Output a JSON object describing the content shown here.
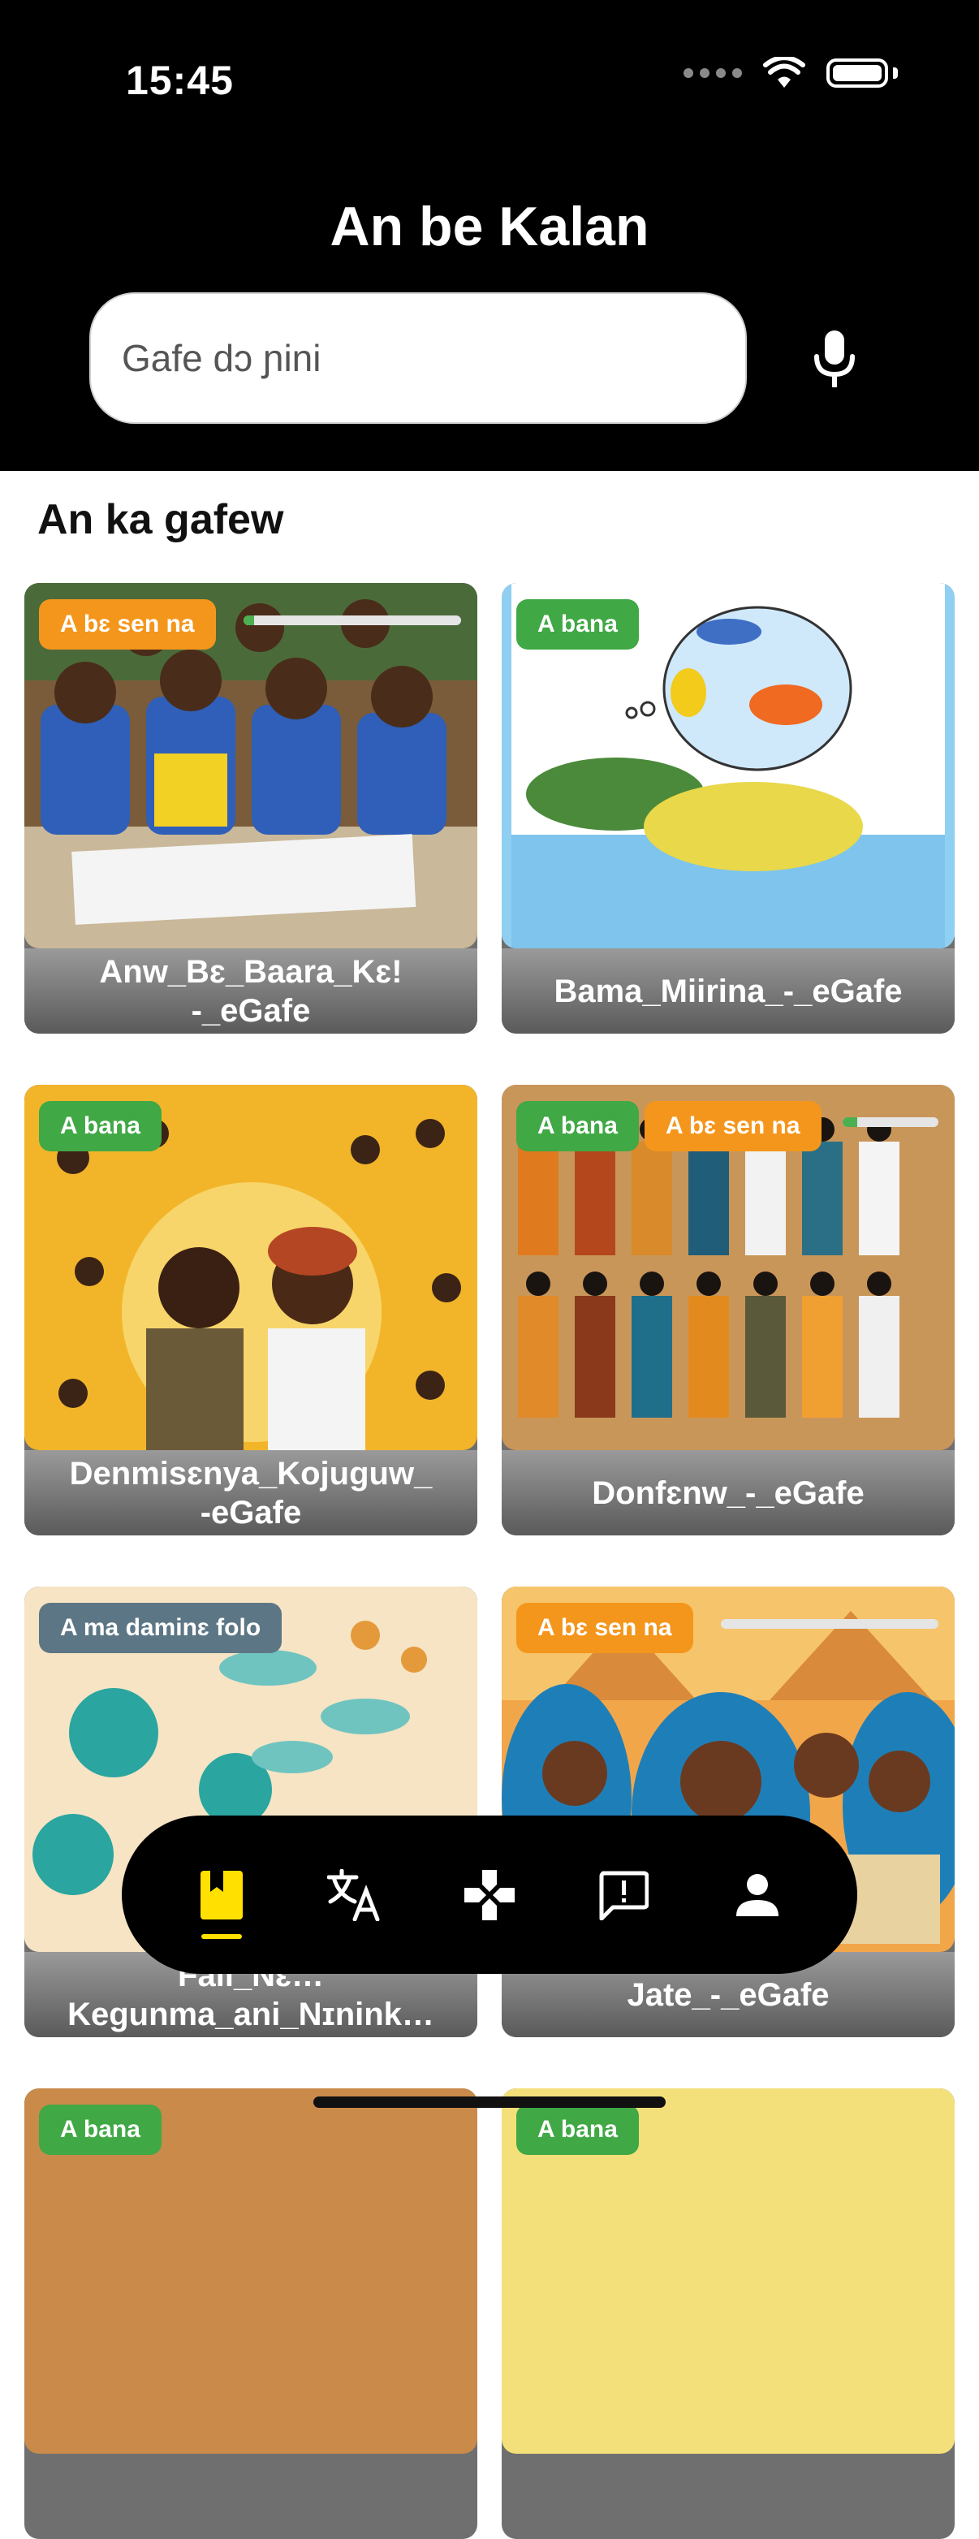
{
  "status_bar": {
    "time": "15:45"
  },
  "header": {
    "title": "An be Kalan",
    "search_placeholder": "Gafe dɔ ɲini",
    "mic_icon": "microphone-icon"
  },
  "section": {
    "title": "An ka gafew"
  },
  "cards": [
    {
      "title": "Anw_Bɛ_Baara_Kɛ!\n-_eGafe",
      "badges": [
        "A bɛ sen na"
      ],
      "progress": 0.05
    },
    {
      "title": "Bama_Miirina_-_eGafe",
      "badges": [
        "A bana"
      ]
    },
    {
      "title": "Denmisɛnya_Kojuguw_\n-eGafe",
      "badges": [
        "A bana"
      ]
    },
    {
      "title": "Donfɛnw_-_eGafe",
      "badges": [
        "A bana",
        "A bɛ sen na"
      ],
      "progress": 0.15
    },
    {
      "title": "Fali_Nɛ…\nKegunma_ani_Nɪnink…",
      "badges": [
        "A ma daminɛ folo"
      ]
    },
    {
      "title": "Jate_-_eGafe",
      "badges": [
        "A bɛ sen na"
      ],
      "progress": 0.0
    },
    {
      "title": "",
      "badges": [
        "A bana"
      ]
    },
    {
      "title": "",
      "badges": [
        "A bana"
      ]
    }
  ],
  "bottom_nav": {
    "items": [
      {
        "name": "library",
        "icon": "bookmark-book-icon",
        "active": true
      },
      {
        "name": "translate",
        "icon": "translate-icon",
        "active": false
      },
      {
        "name": "games",
        "icon": "game-controller-icon",
        "active": false
      },
      {
        "name": "feedback",
        "icon": "feedback-icon",
        "active": false
      },
      {
        "name": "profile",
        "icon": "person-icon",
        "active": false
      }
    ],
    "active_color": "#ffe000"
  }
}
